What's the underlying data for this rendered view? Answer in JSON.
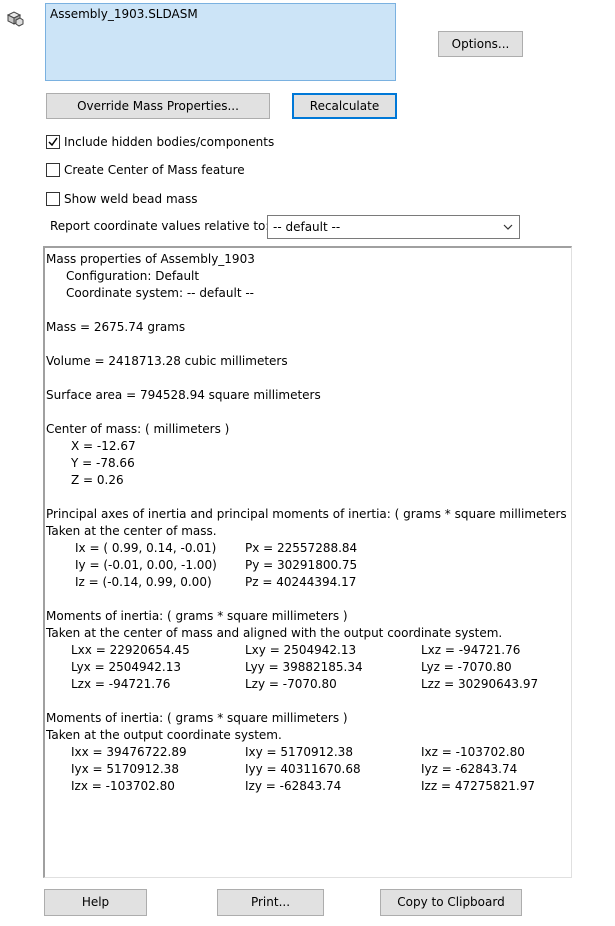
{
  "selection": {
    "item": "Assembly_1903.SLDASM"
  },
  "buttons": {
    "options": "Options...",
    "override": "Override Mass Properties...",
    "recalculate": "Recalculate",
    "help": "Help",
    "print": "Print...",
    "copy": "Copy to Clipboard"
  },
  "checkboxes": [
    {
      "label": "Include hidden bodies/components",
      "checked": true
    },
    {
      "label": "Create Center of Mass feature",
      "checked": false
    },
    {
      "label": "Show weld bead mass",
      "checked": false
    }
  ],
  "report": {
    "label": "Report coordinate values relative to:",
    "value": "-- default --"
  },
  "results": {
    "header": {
      "title": "Mass properties of Assembly_1903",
      "config": "Configuration: Default",
      "coord": "Coordinate system: -- default --"
    },
    "mass": "Mass = 2675.74 grams",
    "volume": "Volume = 2418713.28 cubic millimeters",
    "surface": "Surface area = 794528.94  square millimeters",
    "com": {
      "title": "Center of mass: ( millimeters )",
      "x": "X = -12.67",
      "y": "Y = -78.66",
      "z": "Z = 0.26"
    },
    "principal": {
      "title": "Principal axes of inertia and principal moments of inertia: ( grams *  square millimeters )",
      "sub": "Taken at the center of mass.",
      "rows": [
        [
          "Ix = ( 0.99,  0.14, -0.01)",
          "Px = 22557288.84"
        ],
        [
          "Iy = (-0.01,  0.00, -1.00)",
          "Py = 30291800.75"
        ],
        [
          "Iz = (-0.14,  0.99,  0.00)",
          "Pz = 40244394.17"
        ]
      ]
    },
    "moments_com": {
      "title": "Moments of inertia: ( grams *  square millimeters )",
      "sub": "Taken at the center of mass and aligned with the output coordinate system.",
      "rows": [
        [
          "Lxx = 22920654.45",
          "Lxy = 2504942.13",
          "Lxz = -94721.76"
        ],
        [
          "Lyx = 2504942.13",
          "Lyy = 39882185.34",
          "Lyz = -7070.80"
        ],
        [
          "Lzx = -94721.76",
          "Lzy = -7070.80",
          "Lzz = 30290643.97"
        ]
      ]
    },
    "moments_out": {
      "title": "Moments of inertia: ( grams *  square millimeters )",
      "sub": "Taken at the output coordinate system.",
      "rows": [
        [
          "Ixx = 39476722.89",
          "Ixy = 5170912.38",
          "Ixz = -103702.80"
        ],
        [
          "Iyx = 5170912.38",
          "Iyy = 40311670.68",
          "Iyz = -62843.74"
        ],
        [
          "Izx = -103702.80",
          "Izy = -62843.74",
          "Izz = 47275821.97"
        ]
      ]
    }
  }
}
